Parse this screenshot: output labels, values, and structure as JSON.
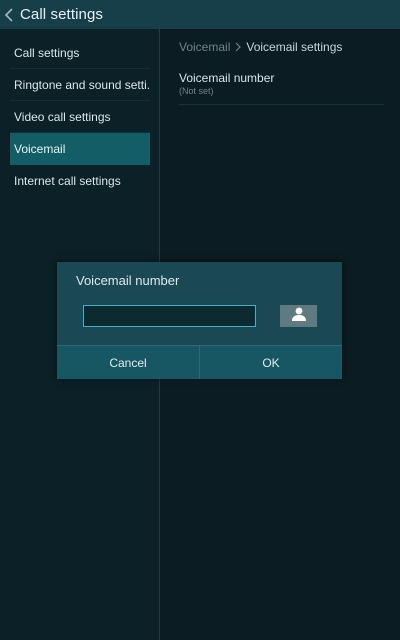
{
  "action_bar": {
    "title": "Call settings",
    "back_icon": "chevron-left-icon"
  },
  "sidebar": {
    "items": [
      {
        "label": "Call settings",
        "selected": false
      },
      {
        "label": "Ringtone and sound setti..",
        "selected": false
      },
      {
        "label": "Video call settings",
        "selected": false
      },
      {
        "label": "Voicemail",
        "selected": true
      },
      {
        "label": "Internet call settings",
        "selected": false
      }
    ]
  },
  "detail": {
    "breadcrumb": {
      "parent": "Voicemail",
      "current": "Voicemail settings"
    },
    "pref": {
      "title": "Voicemail number",
      "summary": "(Not set)"
    }
  },
  "dialog": {
    "title": "Voicemail number",
    "input_value": "",
    "contact_icon": "person-icon",
    "cancel_label": "Cancel",
    "ok_label": "OK"
  },
  "colors": {
    "action_bar": "#173f49",
    "selected_item": "#135d66",
    "dialog_background": "#1a4953",
    "input_border": "#3fb3c6"
  }
}
